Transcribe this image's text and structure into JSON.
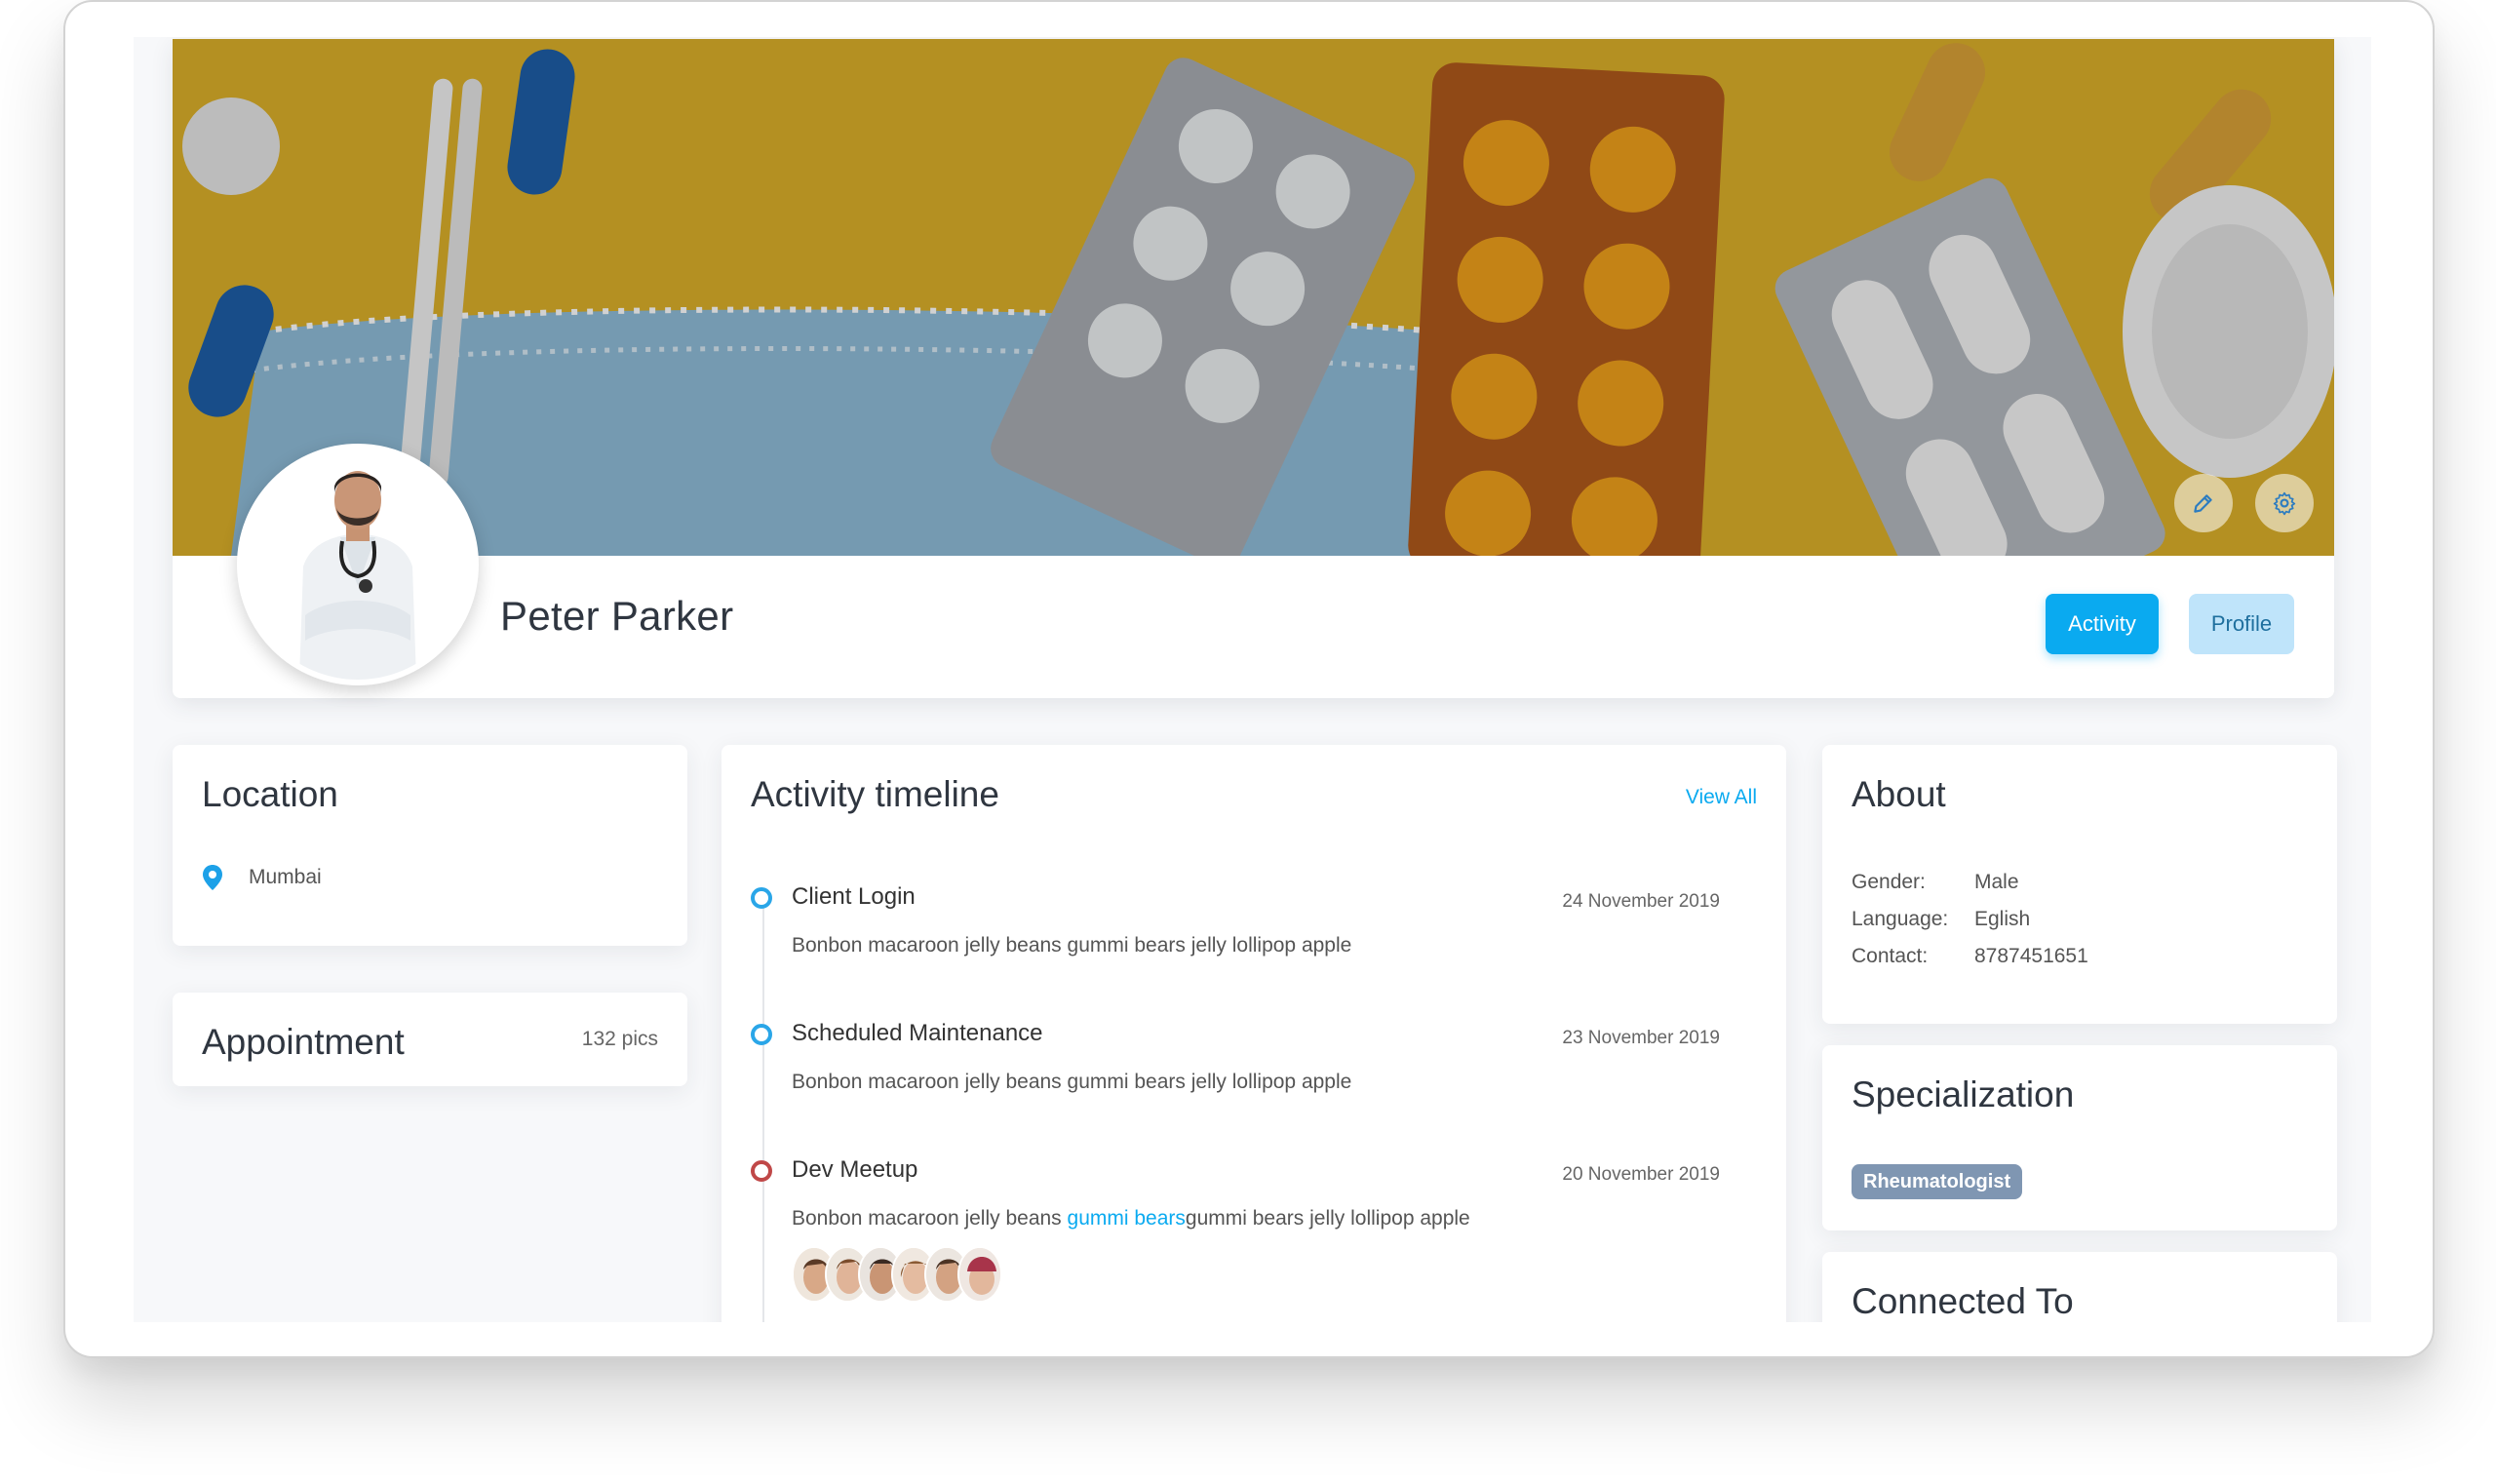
{
  "profile": {
    "name": "Peter Parker",
    "actions": {
      "activity_label": "Activity",
      "profile_label": "Profile"
    },
    "cover_icons": [
      "pencil-icon",
      "gear-icon"
    ]
  },
  "location": {
    "title": "Location",
    "city": "Mumbai",
    "icon": "map-pin-icon"
  },
  "appointment": {
    "title": "Appointment",
    "count": "132 pics"
  },
  "timeline": {
    "title": "Activity timeline",
    "view_all": "View All",
    "items": [
      {
        "title": "Client Login",
        "date": "24 November 2019",
        "desc": "Bonbon macaroon jelly beans gummi bears jelly lollipop apple"
      },
      {
        "title": "Scheduled Maintenance",
        "date": "23 November 2019",
        "desc": "Bonbon macaroon jelly beans gummi bears jelly lollipop apple"
      },
      {
        "title": "Dev Meetup",
        "date": "20 November 2019",
        "desc_before": "Bonbon macaroon jelly beans ",
        "desc_link": "gummi bears",
        "desc_after": "gummi bears jelly lollipop apple"
      }
    ]
  },
  "about": {
    "title": "About",
    "rows": [
      {
        "key": "Gender:",
        "value": "Male"
      },
      {
        "key": "Language:",
        "value": "Eglish"
      },
      {
        "key": "Contact:",
        "value": "8787451651"
      }
    ]
  },
  "specialization": {
    "title": "Specialization",
    "badge": "Rheumatologist"
  },
  "connected": {
    "title": "Connected To"
  },
  "colors": {
    "accent": "#0aaaf0",
    "accent_light": "#bfe4fa",
    "dot_blue": "#2aa6e8",
    "dot_red": "#c04848",
    "badge": "#7f96b2",
    "cover_yellow": "#e1b22a"
  }
}
